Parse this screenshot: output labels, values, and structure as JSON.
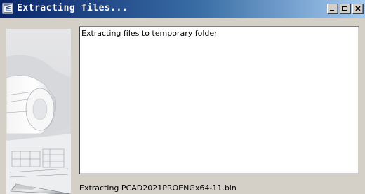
{
  "window": {
    "title": "Extracting files...",
    "colors": {
      "titlebar_start": "#0a246a",
      "titlebar_end": "#a6caf0",
      "face": "#d4d0c8"
    }
  },
  "titlebar_buttons": [
    {
      "icon": "minimize-icon"
    },
    {
      "icon": "maximize-icon"
    },
    {
      "icon": "close-icon"
    }
  ],
  "log": {
    "lines": [
      "Extracting files to temporary folder"
    ]
  },
  "status": {
    "text": "Extracting PCAD2021PROENGx64-11.bin"
  }
}
